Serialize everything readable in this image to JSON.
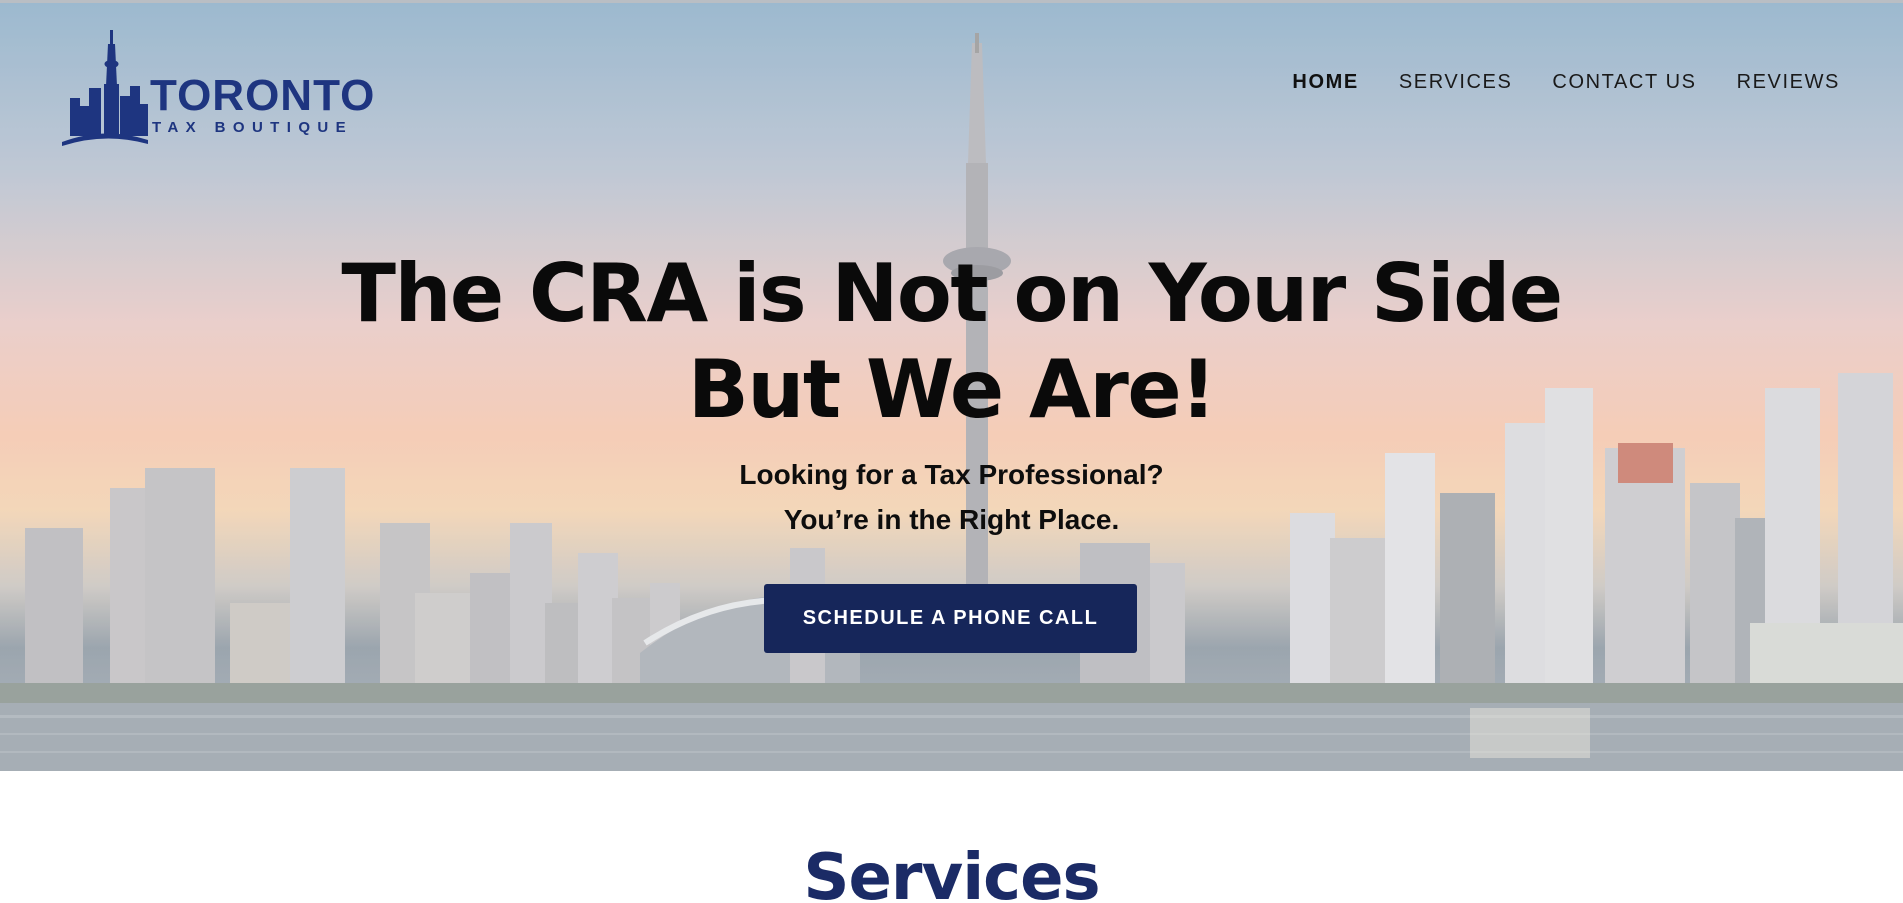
{
  "logo": {
    "word": "TORONTO",
    "sub": "TAX BOUTIQUE",
    "icon": "cn-tower-skyline-icon",
    "color": "#1e3580"
  },
  "nav": {
    "items": [
      {
        "label": "HOME",
        "active": true
      },
      {
        "label": "SERVICES",
        "active": false
      },
      {
        "label": "CONTACT US",
        "active": false
      },
      {
        "label": "REVIEWS",
        "active": false
      }
    ]
  },
  "hero": {
    "headline_line1": "The CRA is Not on Your Side",
    "headline_line2": "But We Are!",
    "sub_line1": "Looking for a Tax Professional?",
    "sub_line2": "You’re in the Right Place.",
    "cta_label": "SCHEDULE A PHONE CALL",
    "cta_color": "#16265a",
    "background": "toronto-skyline-photo"
  },
  "services": {
    "title": "Services",
    "title_color": "#1b2b66"
  }
}
